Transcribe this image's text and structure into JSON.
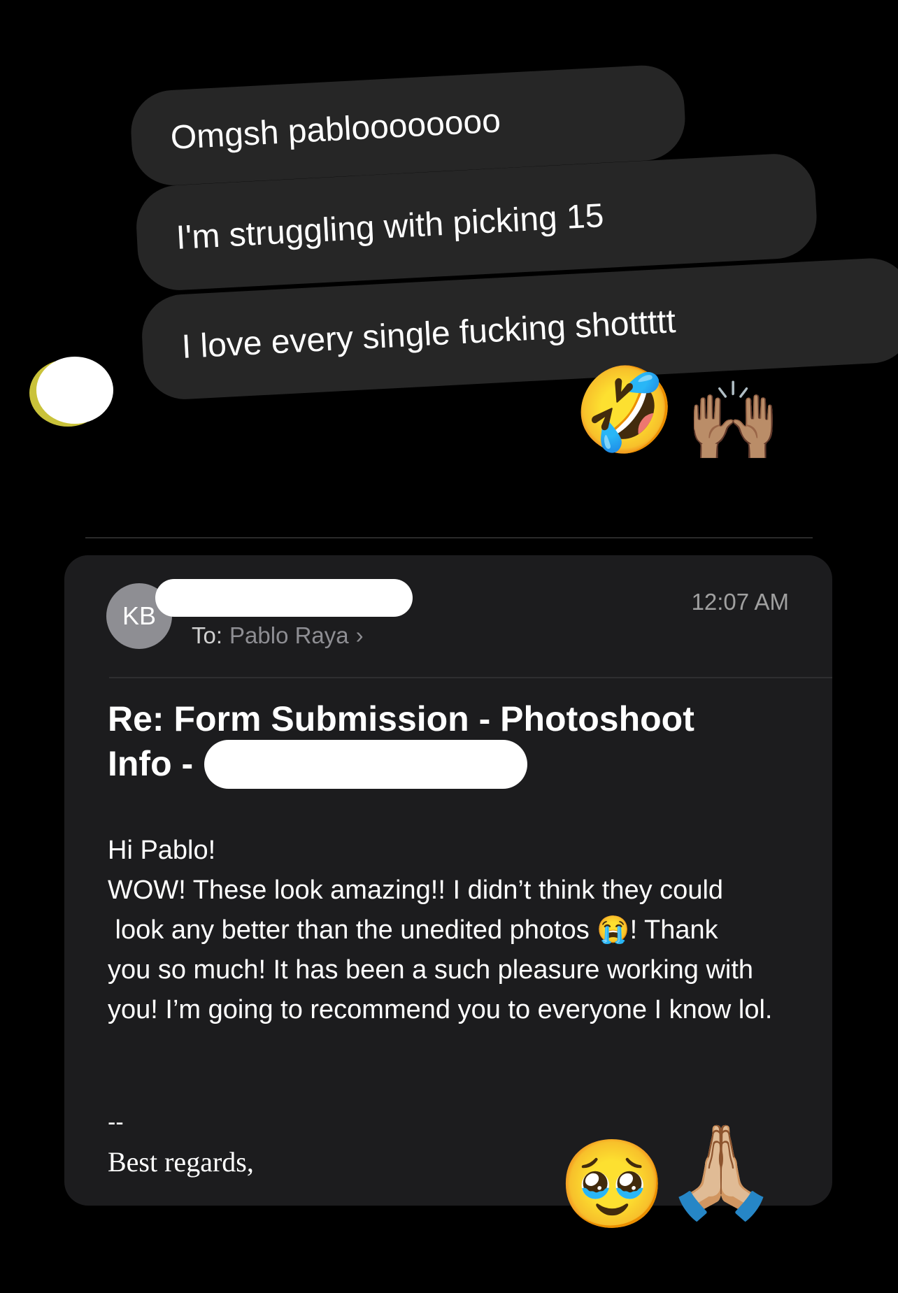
{
  "messages": [
    {
      "text": "Omgsh pabloooooooo"
    },
    {
      "text": "I'm struggling with picking 15"
    },
    {
      "text": "I love every single fucking shottttt"
    }
  ],
  "reaction_emojis": [
    "🤣",
    "🙌🏽"
  ],
  "email": {
    "avatar_initials": "KB",
    "to_label": "To:",
    "to_name": "Pablo Raya",
    "to_chevron": "›",
    "time": "12:07 AM",
    "subject": "Re: Form Submission - Photoshoot Info -",
    "greeting": "Hi Pablo!",
    "body_line1": "WOW! These look amazing!! I didn’t think they could",
    "body_line2a": " look any better than the unedited photos ",
    "body_emoji": "😭",
    "body_line2b": "! Thank",
    "body_rest": "you so much! It has been a such pleasure working with you! I’m going to recommend you to everyone I know lol.",
    "signature_dashes": "--",
    "signoff": "Best regards,"
  },
  "sticker_emojis": [
    "🥹",
    "🙏🏼"
  ],
  "colors": {
    "background": "#000000",
    "bubble": "#262626",
    "card": "#1c1c1e",
    "avatar": "#8e8e93",
    "muted_text": "#8e8e93"
  }
}
